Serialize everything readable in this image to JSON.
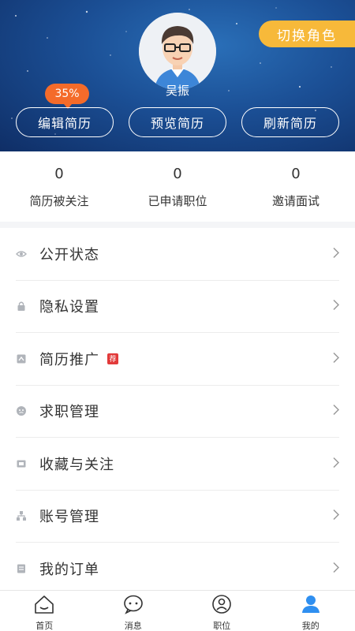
{
  "header": {
    "switch_role": "切换角色",
    "username": "吴振",
    "completion": "35%",
    "buttons": {
      "edit": "编辑简历",
      "preview": "预览简历",
      "refresh": "刷新简历"
    }
  },
  "stats": [
    {
      "value": "0",
      "label": "简历被关注"
    },
    {
      "value": "0",
      "label": "已申请职位"
    },
    {
      "value": "0",
      "label": "邀请面试"
    }
  ],
  "menu": [
    {
      "label": "公开状态",
      "icon": "eye-icon"
    },
    {
      "label": "隐私设置",
      "icon": "lock-icon"
    },
    {
      "label": "简历推广",
      "icon": "promote-icon",
      "tag": "荐"
    },
    {
      "label": "求职管理",
      "icon": "job-manage-icon"
    },
    {
      "label": "收藏与关注",
      "icon": "favorite-icon"
    },
    {
      "label": "账号管理",
      "icon": "account-icon"
    },
    {
      "label": "我的订单",
      "icon": "order-icon"
    }
  ],
  "tabs": [
    {
      "label": "首页",
      "icon": "home-icon"
    },
    {
      "label": "消息",
      "icon": "message-icon"
    },
    {
      "label": "职位",
      "icon": "position-icon"
    },
    {
      "label": "我的",
      "icon": "profile-icon"
    }
  ],
  "colors": {
    "accent": "#2f8ff0",
    "role_button": "#f7b93a",
    "badge": "#f46b2a",
    "tag": "#e23a3a"
  }
}
